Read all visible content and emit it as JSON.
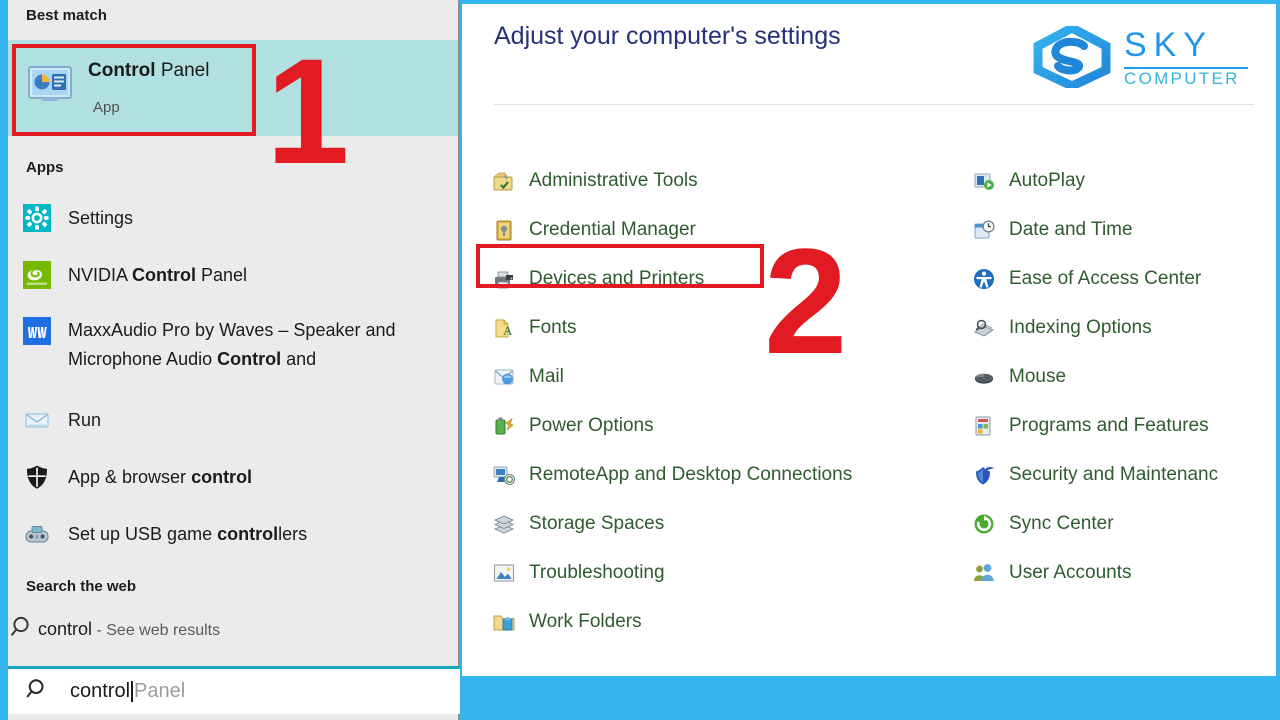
{
  "window": {
    "accent_border_color": "#35b4ef",
    "highlight_color": "#b1e0e0",
    "annotation_color": "#e21b22"
  },
  "start_menu": {
    "best_match_header": "Best match",
    "best_match": {
      "icon": "control-panel-icon",
      "title_bold": "Control",
      "title_rest": " Panel",
      "subtitle": "App"
    },
    "apps_header": "Apps",
    "apps": [
      {
        "icon": "settings-gear-icon",
        "label_html": "Settings"
      },
      {
        "icon": "nvidia-icon",
        "label_html": "NVIDIA <b>Control</b> Panel"
      },
      {
        "icon": "maxxaudio-icon",
        "label_html": "MaxxAudio Pro by Waves – Speaker and Microphone Audio <b>Control</b> and"
      },
      {
        "icon": "run-icon",
        "label_html": "Run"
      },
      {
        "icon": "shield-icon",
        "label_html": "App &amp; browser <b>control</b>"
      },
      {
        "icon": "gamepad-icon",
        "label_html": "Set up USB game <b>control</b>lers"
      }
    ],
    "search_web_header": "Search the web",
    "web_result": {
      "icon": "search-icon",
      "query": "control",
      "suffix": " - See web results"
    },
    "search_input": {
      "icon": "search-icon",
      "typed_value": "control",
      "suggestion_remainder": "Panel"
    }
  },
  "control_panel": {
    "title": "Adjust your computer's settings",
    "logo": {
      "mark": "sky-hexagon-s-logo",
      "primary_text": "SKY",
      "secondary_text": "COMPUTER"
    },
    "items_left": [
      {
        "icon": "administrative-tools-icon",
        "label": "Administrative Tools"
      },
      {
        "icon": "credential-manager-icon",
        "label": "Credential Manager"
      },
      {
        "icon": "devices-and-printers-icon",
        "label": "Devices and Printers"
      },
      {
        "icon": "fonts-icon",
        "label": "Fonts"
      },
      {
        "icon": "mail-icon",
        "label": "Mail"
      },
      {
        "icon": "power-options-icon",
        "label": "Power Options"
      },
      {
        "icon": "remoteapp-icon",
        "label": "RemoteApp and Desktop Connections"
      },
      {
        "icon": "storage-spaces-icon",
        "label": "Storage Spaces"
      },
      {
        "icon": "troubleshooting-icon",
        "label": "Troubleshooting"
      },
      {
        "icon": "work-folders-icon",
        "label": "Work Folders"
      }
    ],
    "items_right": [
      {
        "icon": "autoplay-icon",
        "label": "AutoPlay"
      },
      {
        "icon": "date-and-time-icon",
        "label": "Date and Time"
      },
      {
        "icon": "ease-of-access-icon",
        "label": "Ease of Access Center"
      },
      {
        "icon": "indexing-options-icon",
        "label": "Indexing Options"
      },
      {
        "icon": "mouse-icon",
        "label": "Mouse"
      },
      {
        "icon": "programs-and-features-icon",
        "label": "Programs and Features"
      },
      {
        "icon": "security-maintenance-icon",
        "label": "Security and Maintenanc"
      },
      {
        "icon": "sync-center-icon",
        "label": "Sync Center"
      },
      {
        "icon": "user-accounts-icon",
        "label": "User Accounts"
      }
    ]
  },
  "annotations": {
    "step_one": "1",
    "step_two": "2"
  }
}
